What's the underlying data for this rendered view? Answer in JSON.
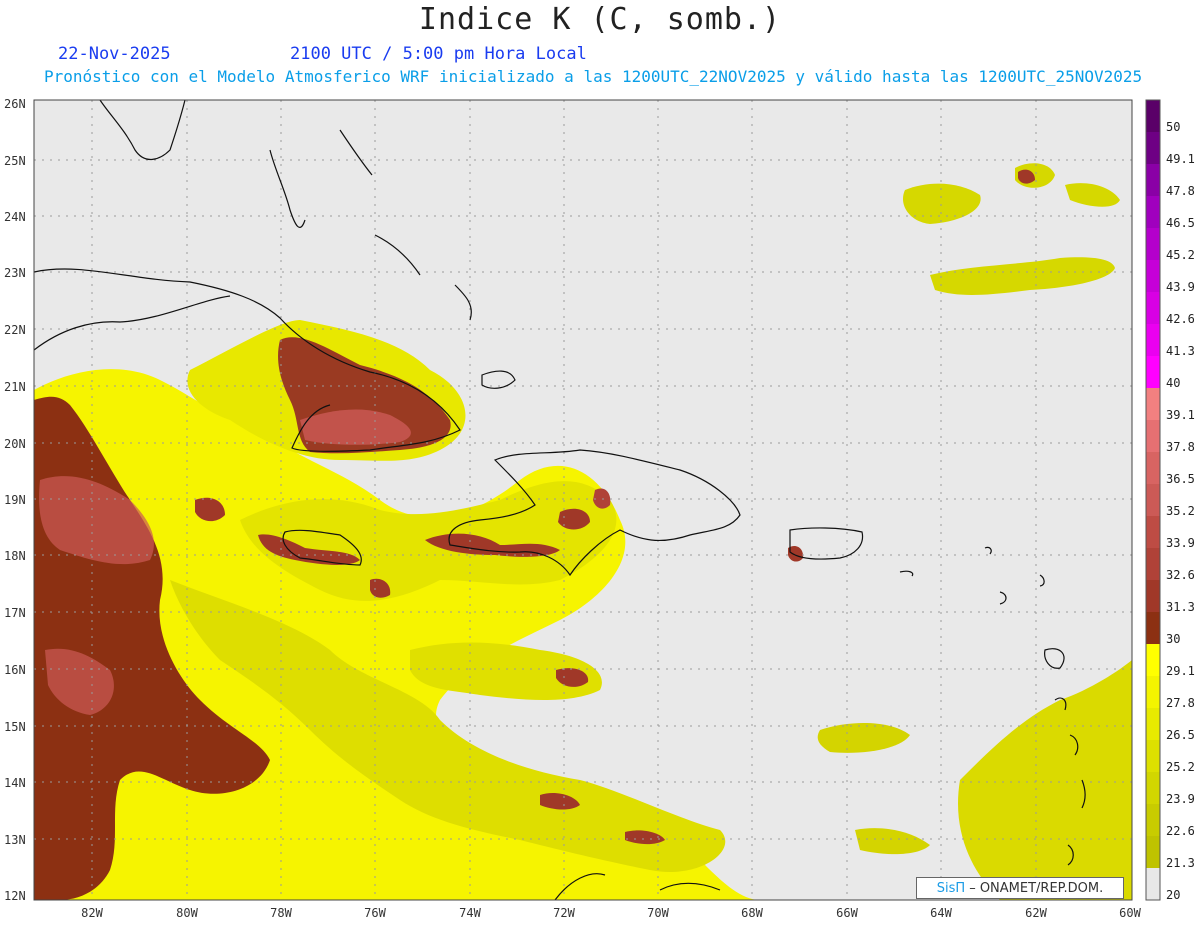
{
  "title": "Indice K (C, somb.)",
  "date": "22-Nov-2025",
  "time": "2100 UTC / 5:00 pm Hora Local",
  "subtitle": "Pronóstico con el Modelo Atmosferico WRF inicializado a las 1200UTC_22NOV2025 y válido hasta las  1200UTC_25NOV2025",
  "lat_labels": [
    "26N",
    "25N",
    "24N",
    "23N",
    "22N",
    "21N",
    "20N",
    "19N",
    "18N",
    "17N",
    "16N",
    "15N",
    "14N",
    "13N",
    "12N"
  ],
  "lon_labels": [
    "82W",
    "80W",
    "78W",
    "76W",
    "74W",
    "72W",
    "70W",
    "68W",
    "66W",
    "64W",
    "62W",
    "60W"
  ],
  "legend": {
    "levels": [
      "50",
      "49.1",
      "47.8",
      "46.5",
      "45.2",
      "43.9",
      "42.6",
      "41.3",
      "40",
      "39.1",
      "37.8",
      "36.5",
      "35.2",
      "33.9",
      "32.6",
      "31.3",
      "30",
      "29.1",
      "27.8",
      "26.5",
      "25.2",
      "23.9",
      "22.6",
      "21.3",
      "20"
    ],
    "colors": [
      "#5a0068",
      "#6e0084",
      "#8a00a6",
      "#a000be",
      "#b400cc",
      "#c600d8",
      "#d800e4",
      "#ea00f0",
      "#ff00ff",
      "#f28080",
      "#e67072",
      "#d86462",
      "#cc5a56",
      "#be4c44",
      "#b04238",
      "#a03828",
      "#8c3012",
      "#ffff00",
      "#f4f400",
      "#e8ea00",
      "#dde000",
      "#d2d600",
      "#c8cc00",
      "#bfc300",
      "#e8e8e8"
    ]
  },
  "credit": {
    "brand": "SisΠ",
    "org": "– ONAMET/REP.DOM."
  }
}
